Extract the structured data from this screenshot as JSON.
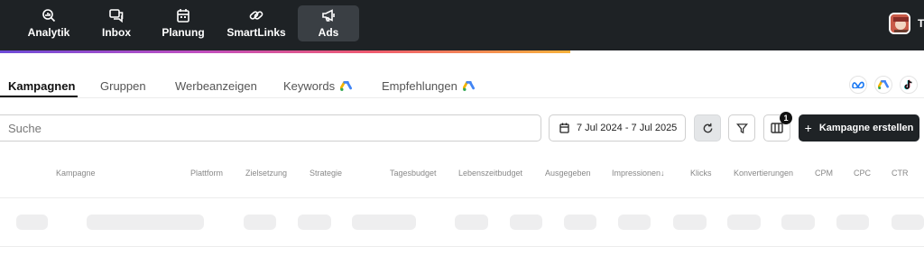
{
  "nav": {
    "items": [
      {
        "label": "Analytik",
        "icon": "analytics-icon"
      },
      {
        "label": "Inbox",
        "icon": "inbox-icon"
      },
      {
        "label": "Planung",
        "icon": "calendar-icon"
      },
      {
        "label": "SmartLinks",
        "icon": "link-icon"
      },
      {
        "label": "Ads",
        "icon": "megaphone-icon",
        "active": true
      }
    ],
    "user_initial": "T"
  },
  "tabs": [
    {
      "label": "Kampagnen",
      "active": true
    },
    {
      "label": "Gruppen"
    },
    {
      "label": "Werbeanzeigen"
    },
    {
      "label": "Keywords",
      "icon": "google-ads-icon"
    },
    {
      "label": "Empfehlungen",
      "icon": "google-ads-icon"
    }
  ],
  "platforms": [
    "meta-icon",
    "google-ads-icon",
    "tiktok-icon"
  ],
  "toolbar": {
    "search_placeholder": "Suche",
    "date_range": "7 Jul 2024 - 7 Jul 2025",
    "columns_badge": "1",
    "create_label": "Kampagne erstellen"
  },
  "table": {
    "columns": [
      "Kampagne",
      "Plattform",
      "Zielsetzung",
      "Strategie",
      "Tagesbudget",
      "Lebenszeitbudget",
      "Ausgegeben",
      "Impressionen↓",
      "Klicks",
      "Konvertierungen",
      "CPM",
      "CPC",
      "CTR"
    ]
  },
  "colors": {
    "topbar": "#1e2225",
    "primary_button": "#1f2326",
    "gradient": [
      "#6d4bd8",
      "#c04ec0",
      "#ef5a6f",
      "#f7b23b"
    ]
  }
}
